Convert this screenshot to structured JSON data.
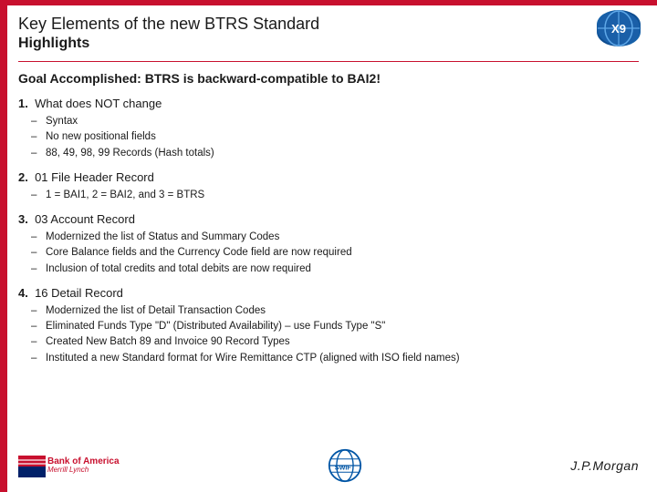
{
  "leftbar": {
    "color": "#c8102e"
  },
  "header": {
    "title": "Key Elements of the new BTRS Standard",
    "subtitle": "Highlights"
  },
  "goal": {
    "text": "Goal Accomplished:  BTRS is backward-compatible to BAI2!"
  },
  "sections": [
    {
      "number": "1.",
      "heading": "What does NOT change",
      "bullets": [
        "Syntax",
        "No new positional fields",
        "88, 49, 98, 99 Records  (Hash totals)"
      ]
    },
    {
      "number": "2.",
      "heading": "01 File Header Record",
      "bullets": [
        "1 = BAI1,  2 = BAI2, and 3 = BTRS"
      ]
    },
    {
      "number": "3.",
      "heading": "03 Account Record",
      "bullets": [
        "Modernized the list of Status and Summary Codes",
        "Core Balance fields and the Currency Code field are now required",
        "Inclusion of total credits and total debits are now required"
      ]
    },
    {
      "number": "4.",
      "heading": "16 Detail Record",
      "bullets": [
        "Modernized the list of Detail Transaction Codes",
        "Eliminated Funds Type \"D\" (Distributed Availability) – use Funds Type \"S\"",
        "Created New Batch 89 and Invoice 90 Record Types",
        "Instituted a new Standard format for Wire Remittance CTP (aligned with ISO field names)"
      ]
    }
  ],
  "footer": {
    "bofa_line1": "Bank of America",
    "bofa_line2": "Merrill Lynch",
    "jpmorgan": "J.P.Morgan"
  },
  "logo": {
    "text": "X9"
  }
}
